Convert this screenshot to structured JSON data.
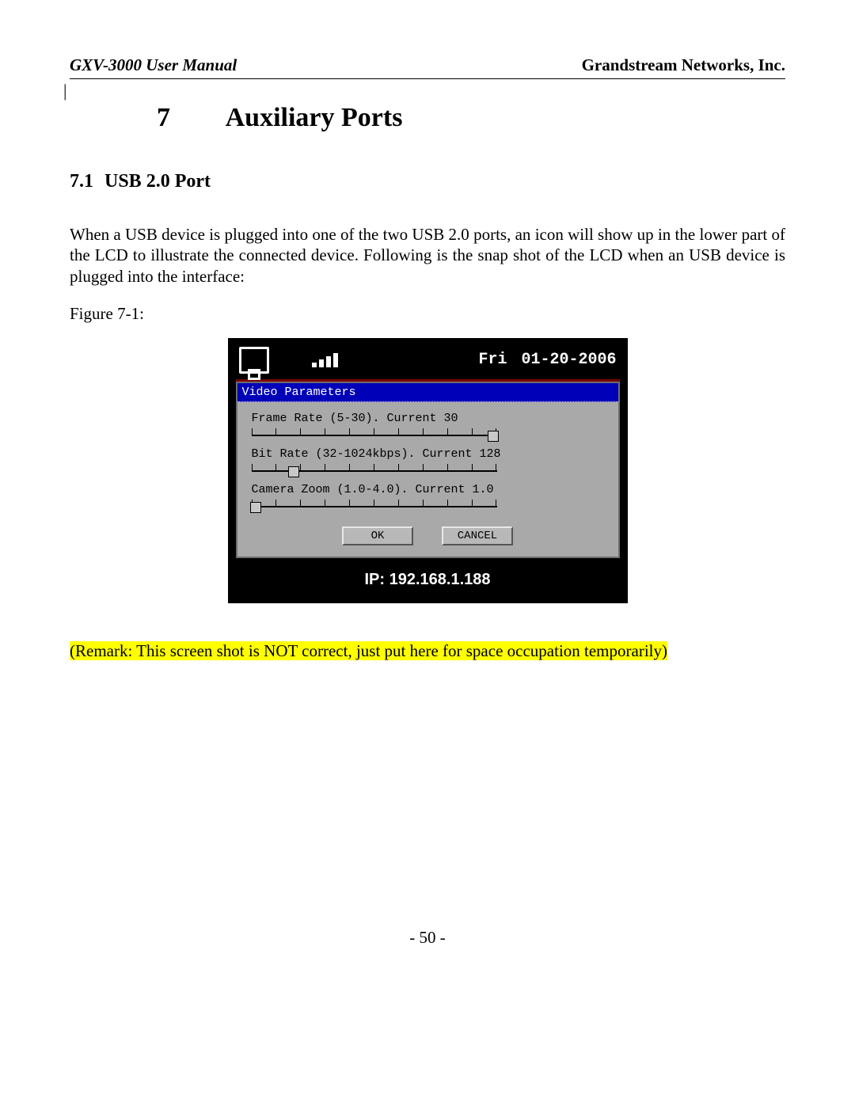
{
  "header": {
    "left": "GXV-3000 User Manual",
    "right": "Grandstream Networks, Inc."
  },
  "chapter": {
    "number": "7",
    "title": "Auxiliary Ports"
  },
  "section": {
    "number": "7.1",
    "title": "USB 2.0 Port"
  },
  "paragraph": "When a USB device is plugged into one of the two USB 2.0 ports, an icon will show up in the lower part of the LCD to illustrate the connected device. Following is the snap shot of the LCD when an USB device is plugged into the interface:",
  "figure_label": "Figure 7-1:",
  "lcd": {
    "day": "Fri",
    "date": "01-20-2006",
    "panel_title": "Video Parameters",
    "frame_rate_label": "Frame Rate (5-30). Current 30",
    "bit_rate_label": "Bit Rate (32-1024kbps). Current 128",
    "zoom_label": "Camera Zoom (1.0-4.0). Current 1.0",
    "ok": "OK",
    "cancel": "CANCEL",
    "ip": "IP: 192.168.1.188"
  },
  "remark": "(Remark: This screen shot is NOT correct, just put here for space occupation temporarily)",
  "page_number": "- 50 -"
}
